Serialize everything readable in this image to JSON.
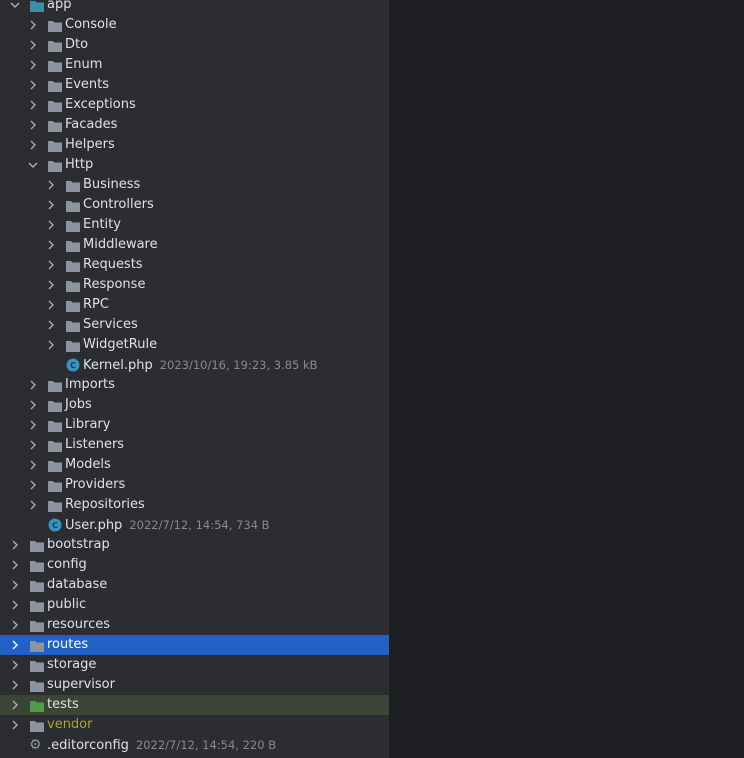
{
  "colors": {
    "panel": "#2b2d30",
    "editor": "#1e1f22",
    "selection": "#2160c4",
    "folder": "#8c959f",
    "folder_module": "#3d8fa8",
    "folder_test": "#4f9d47",
    "excluded_text": "#a8a632",
    "php_class": "#3592c4"
  },
  "tree": [
    {
      "name": "app",
      "level": 0,
      "type": "folder-module",
      "expanded": true
    },
    {
      "name": "Console",
      "level": 1,
      "type": "folder"
    },
    {
      "name": "Dto",
      "level": 1,
      "type": "folder"
    },
    {
      "name": "Enum",
      "level": 1,
      "type": "folder"
    },
    {
      "name": "Events",
      "level": 1,
      "type": "folder"
    },
    {
      "name": "Exceptions",
      "level": 1,
      "type": "folder"
    },
    {
      "name": "Facades",
      "level": 1,
      "type": "folder"
    },
    {
      "name": "Helpers",
      "level": 1,
      "type": "folder"
    },
    {
      "name": "Http",
      "level": 1,
      "type": "folder",
      "expanded": true
    },
    {
      "name": "Business",
      "level": 2,
      "type": "folder"
    },
    {
      "name": "Controllers",
      "level": 2,
      "type": "folder"
    },
    {
      "name": "Entity",
      "level": 2,
      "type": "folder"
    },
    {
      "name": "Middleware",
      "level": 2,
      "type": "folder"
    },
    {
      "name": "Requests",
      "level": 2,
      "type": "folder"
    },
    {
      "name": "Response",
      "level": 2,
      "type": "folder"
    },
    {
      "name": "RPC",
      "level": 2,
      "type": "folder"
    },
    {
      "name": "Services",
      "level": 2,
      "type": "folder"
    },
    {
      "name": "WidgetRule",
      "level": 2,
      "type": "folder"
    },
    {
      "name": "Kernel.php",
      "level": 2,
      "type": "php-class",
      "meta": "2023/10/16, 19:23, 3.85 kB"
    },
    {
      "name": "Imports",
      "level": 1,
      "type": "folder"
    },
    {
      "name": "Jobs",
      "level": 1,
      "type": "folder"
    },
    {
      "name": "Library",
      "level": 1,
      "type": "folder"
    },
    {
      "name": "Listeners",
      "level": 1,
      "type": "folder"
    },
    {
      "name": "Models",
      "level": 1,
      "type": "folder"
    },
    {
      "name": "Providers",
      "level": 1,
      "type": "folder"
    },
    {
      "name": "Repositories",
      "level": 1,
      "type": "folder"
    },
    {
      "name": "User.php",
      "level": 1,
      "type": "php-class",
      "meta": "2022/7/12, 14:54, 734 B"
    },
    {
      "name": "bootstrap",
      "level": 0,
      "type": "folder"
    },
    {
      "name": "config",
      "level": 0,
      "type": "folder"
    },
    {
      "name": "database",
      "level": 0,
      "type": "folder"
    },
    {
      "name": "public",
      "level": 0,
      "type": "folder"
    },
    {
      "name": "resources",
      "level": 0,
      "type": "folder"
    },
    {
      "name": "routes",
      "level": 0,
      "type": "folder",
      "selected": true
    },
    {
      "name": "storage",
      "level": 0,
      "type": "folder"
    },
    {
      "name": "supervisor",
      "level": 0,
      "type": "folder"
    },
    {
      "name": "tests",
      "level": 0,
      "type": "folder-test",
      "state": "tests"
    },
    {
      "name": "vendor",
      "level": 0,
      "type": "folder",
      "state": "excluded"
    },
    {
      "name": ".editorconfig",
      "level": 0,
      "type": "config-file",
      "meta": "2022/7/12, 14:54, 220 B"
    }
  ]
}
